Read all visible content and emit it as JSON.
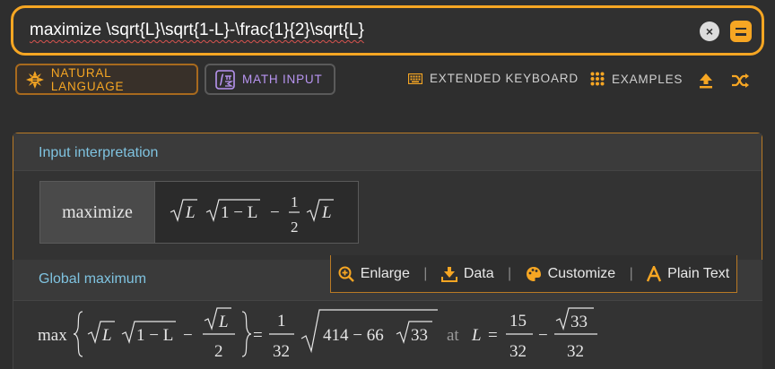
{
  "search": {
    "query": "maximize \\sqrt{L}\\sqrt{1-L}-\\frac{1}{2}\\sqrt{L}",
    "clear_icon": "×"
  },
  "modes": {
    "natural_language": "NATURAL LANGUAGE",
    "math_input": "MATH INPUT"
  },
  "toolbar": {
    "extended_keyboard": "EXTENDED KEYBOARD",
    "examples": "EXAMPLES"
  },
  "input_interpretation": {
    "title": "Input interpretation",
    "operation": "maximize",
    "expression": {
      "t1": "L",
      "t2": "1 − L",
      "minus": "−",
      "num": "1",
      "den": "2",
      "t3": "L"
    }
  },
  "global_maximum": {
    "title": "Global maximum",
    "max_word": "max",
    "lhs_t1": "L",
    "lhs_t2": "1 − L",
    "lhs_minus": "−",
    "lhs_frac_num": "L",
    "lhs_frac_den": "2",
    "equals": "=",
    "coef_num": "1",
    "coef_den": "32",
    "radicand": "414 − 66",
    "inner_root": "33",
    "at_word": "at",
    "var": "L",
    "eq2": "=",
    "frac1_num": "15",
    "frac1_den": "32",
    "minus2": "−",
    "frac2_num": "33",
    "frac2_den": "32"
  },
  "result_actions": {
    "enlarge": "Enlarge",
    "data": "Data",
    "customize": "Customize",
    "plain_text": "Plain Text",
    "separator": "|"
  },
  "colors": {
    "accent": "#f6a623",
    "pod_title": "#7fc3e0",
    "math_input": "#b794f0",
    "background": "#2e2e2e"
  }
}
